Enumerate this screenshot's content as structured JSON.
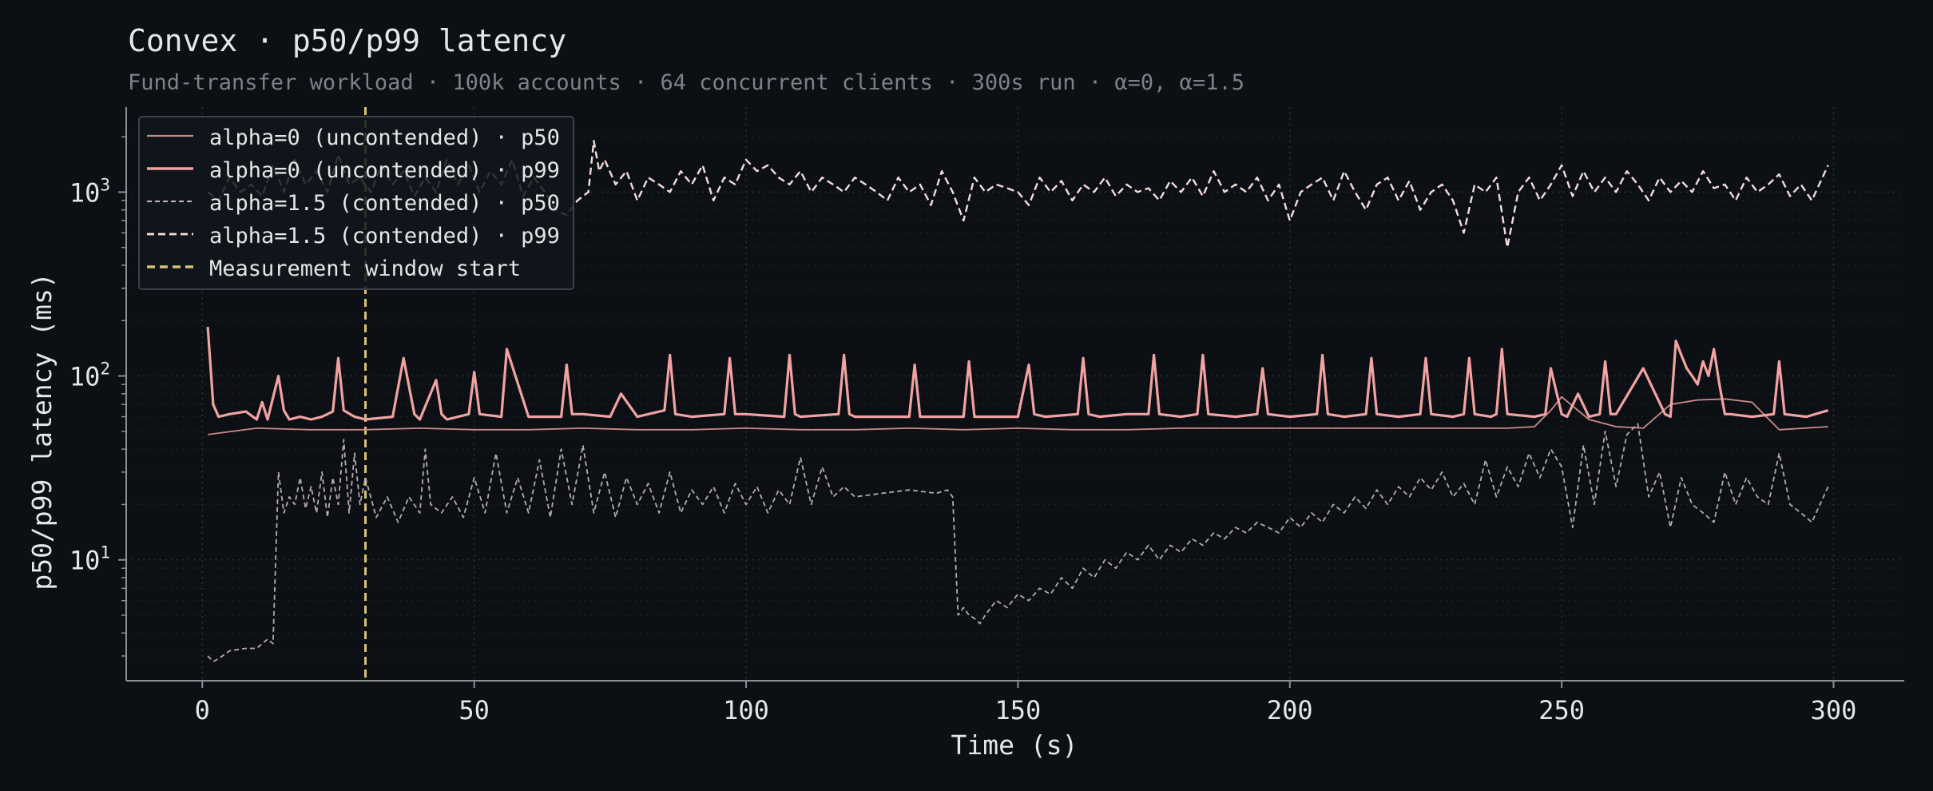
{
  "chart_data": {
    "type": "line",
    "title": "Convex · p50/p99 latency",
    "subtitle": "Fund-transfer workload · 100k accounts · 64 concurrent clients · 300s run · α=0, α=1.5",
    "xlabel": "Time (s)",
    "ylabel": "p50/p99 latency (ms)",
    "xlim": [
      -14,
      313
    ],
    "ylim": [
      2.2,
      2900
    ],
    "yscale": "log",
    "grid": true,
    "xticks": [
      0,
      50,
      100,
      150,
      200,
      250,
      300
    ],
    "xtick_labels": [
      "0",
      "50",
      "100",
      "150",
      "200",
      "250",
      "300"
    ],
    "yticks": [
      10,
      100,
      1000
    ],
    "ytick_labels": [
      {
        "base": "10",
        "exp": "1"
      },
      {
        "base": "10",
        "exp": "2"
      },
      {
        "base": "10",
        "exp": "3"
      }
    ],
    "legend_position": "top-left",
    "vline": {
      "x": 30,
      "name": "Measurement window start",
      "color": "#d8c27a"
    },
    "colors": {
      "alpha0_p50": "#c98a8a",
      "alpha0_p99": "#f2a2a2",
      "alpha15_p50": "#b8aaaa",
      "alpha15_p99": "#f4dcdc",
      "axis": "#8a8f95",
      "text": "#e6e6e6",
      "subtext": "#7c8288",
      "grid": "#2a3138"
    },
    "series": [
      {
        "name": "alpha=0 (uncontended) · p50",
        "style": "solid",
        "x": [
          1,
          10,
          20,
          30,
          40,
          50,
          60,
          70,
          80,
          90,
          100,
          110,
          120,
          130,
          140,
          150,
          160,
          170,
          180,
          190,
          200,
          210,
          220,
          230,
          240,
          245,
          248,
          250,
          255,
          260,
          265,
          270,
          275,
          280,
          285,
          290,
          299
        ],
        "values": [
          48,
          52,
          51,
          51,
          52,
          51,
          51,
          52,
          51,
          51,
          52,
          51,
          51,
          52,
          51,
          52,
          51,
          51,
          52,
          52,
          52,
          52,
          52,
          52,
          52,
          53,
          65,
          77,
          58,
          53,
          52,
          70,
          74,
          75,
          72,
          51,
          53
        ]
      },
      {
        "name": "alpha=0 (uncontended) · p99",
        "style": "solid",
        "x": [
          1,
          2,
          3,
          5,
          8,
          10,
          11,
          12,
          14,
          15,
          16,
          18,
          20,
          22,
          24,
          25,
          26,
          28,
          30,
          35,
          37,
          39,
          40,
          43,
          44,
          45,
          49,
          50,
          51,
          55,
          56,
          60,
          66,
          67,
          68,
          70,
          75,
          77,
          80,
          85,
          86,
          87,
          90,
          96,
          97,
          98,
          100,
          107,
          108,
          109,
          110,
          117,
          118,
          119,
          120,
          130,
          131,
          132,
          135,
          140,
          141,
          142,
          145,
          150,
          152,
          153,
          155,
          161,
          162,
          163,
          165,
          170,
          174,
          175,
          176,
          180,
          183,
          184,
          185,
          190,
          194,
          195,
          196,
          200,
          205,
          206,
          207,
          210,
          214,
          215,
          216,
          220,
          224,
          225,
          226,
          230,
          232,
          233,
          234,
          237,
          238,
          239,
          240,
          245,
          247,
          248,
          250,
          251,
          253,
          255,
          257,
          258,
          259,
          260,
          265,
          269,
          270,
          271,
          272,
          273,
          274,
          275,
          276,
          277,
          278,
          279,
          280,
          281,
          285,
          289,
          290,
          291,
          295,
          299
        ],
        "values": [
          185,
          70,
          60,
          62,
          64,
          58,
          72,
          58,
          100,
          65,
          58,
          60,
          58,
          60,
          64,
          125,
          65,
          60,
          58,
          60,
          125,
          62,
          58,
          95,
          62,
          58,
          62,
          105,
          62,
          60,
          140,
          60,
          60,
          115,
          62,
          62,
          60,
          80,
          60,
          65,
          130,
          62,
          60,
          62,
          125,
          62,
          62,
          60,
          130,
          62,
          60,
          62,
          130,
          62,
          60,
          60,
          115,
          60,
          60,
          60,
          120,
          60,
          60,
          60,
          115,
          62,
          60,
          62,
          125,
          62,
          60,
          62,
          62,
          130,
          62,
          60,
          62,
          130,
          62,
          60,
          62,
          110,
          62,
          60,
          62,
          130,
          62,
          60,
          62,
          125,
          62,
          60,
          62,
          125,
          62,
          60,
          62,
          125,
          62,
          60,
          62,
          140,
          62,
          60,
          62,
          110,
          62,
          60,
          80,
          60,
          62,
          120,
          62,
          62,
          110,
          62,
          60,
          155,
          130,
          110,
          100,
          90,
          120,
          100,
          140,
          90,
          62,
          62,
          60,
          62,
          120,
          62,
          60,
          65
        ]
      },
      {
        "name": "alpha=1.5 (contended) · p50",
        "style": "dashed",
        "x": [
          1,
          2,
          3,
          5,
          8,
          10,
          11,
          12,
          13,
          14,
          15,
          16,
          17,
          18,
          19,
          20,
          21,
          22,
          23,
          24,
          25,
          26,
          27,
          28,
          29,
          30,
          32,
          34,
          36,
          38,
          40,
          41,
          42,
          44,
          46,
          48,
          50,
          52,
          54,
          56,
          58,
          60,
          62,
          64,
          66,
          68,
          70,
          72,
          74,
          76,
          78,
          80,
          82,
          84,
          86,
          88,
          90,
          92,
          94,
          96,
          98,
          100,
          102,
          104,
          106,
          108,
          110,
          112,
          114,
          116,
          118,
          120,
          125,
          130,
          135,
          137,
          138,
          139,
          140,
          141,
          142,
          143,
          144,
          145,
          146,
          148,
          150,
          152,
          154,
          156,
          158,
          160,
          162,
          164,
          166,
          168,
          170,
          172,
          174,
          176,
          178,
          180,
          182,
          184,
          186,
          188,
          190,
          192,
          194,
          196,
          198,
          200,
          202,
          204,
          206,
          208,
          210,
          212,
          214,
          216,
          218,
          220,
          222,
          224,
          226,
          228,
          230,
          232,
          234,
          236,
          238,
          240,
          242,
          244,
          246,
          248,
          250,
          252,
          254,
          256,
          258,
          260,
          262,
          264,
          266,
          268,
          270,
          272,
          274,
          276,
          278,
          280,
          282,
          284,
          286,
          288,
          290,
          292,
          294,
          296,
          299
        ],
        "values": [
          3,
          2.8,
          2.9,
          3.2,
          3.3,
          3.3,
          3.5,
          3.7,
          3.5,
          30,
          18,
          22,
          20,
          28,
          19,
          25,
          18,
          30,
          17,
          28,
          20,
          45,
          18,
          38,
          20,
          28,
          17,
          22,
          16,
          22,
          18,
          40,
          20,
          18,
          22,
          17,
          28,
          18,
          38,
          18,
          28,
          18,
          35,
          17,
          40,
          20,
          42,
          18,
          30,
          17,
          28,
          20,
          26,
          18,
          30,
          18,
          24,
          20,
          25,
          18,
          26,
          20,
          25,
          18,
          24,
          20,
          36,
          20,
          32,
          22,
          25,
          22,
          23,
          24,
          23,
          24,
          22,
          5,
          5.5,
          5,
          4.8,
          4.5,
          5,
          5.5,
          6,
          5.5,
          6.5,
          6,
          7,
          6.5,
          8,
          7,
          9,
          8,
          10,
          9,
          11,
          10,
          12,
          10,
          12,
          11,
          13,
          12,
          14,
          13,
          15,
          14,
          16,
          15,
          14,
          17,
          15,
          18,
          16,
          20,
          18,
          22,
          19,
          24,
          20,
          25,
          22,
          28,
          24,
          30,
          22,
          26,
          20,
          35,
          22,
          32,
          25,
          38,
          28,
          40,
          32,
          15,
          42,
          20,
          50,
          25,
          48,
          55,
          22,
          30,
          15,
          28,
          20,
          18,
          16,
          30,
          20,
          28,
          22,
          20,
          38,
          20,
          18,
          16,
          25
        ]
      },
      {
        "name": "alpha=1.5 (contended) · p99",
        "style": "dashed",
        "x": [
          1,
          3,
          5,
          7,
          9,
          11,
          13,
          15,
          17,
          19,
          21,
          23,
          25,
          27,
          29,
          31,
          33,
          35,
          37,
          39,
          41,
          43,
          45,
          47,
          49,
          51,
          53,
          55,
          57,
          59,
          61,
          63,
          65,
          67,
          69,
          71,
          72,
          73,
          74,
          76,
          78,
          80,
          82,
          84,
          86,
          88,
          90,
          92,
          94,
          96,
          98,
          100,
          102,
          104,
          106,
          108,
          110,
          112,
          114,
          116,
          118,
          120,
          122,
          124,
          126,
          128,
          130,
          132,
          134,
          136,
          138,
          140,
          142,
          144,
          146,
          148,
          150,
          152,
          154,
          156,
          158,
          160,
          162,
          164,
          166,
          168,
          170,
          172,
          174,
          176,
          178,
          180,
          182,
          184,
          186,
          188,
          190,
          192,
          194,
          196,
          198,
          200,
          202,
          204,
          206,
          208,
          210,
          212,
          214,
          216,
          218,
          220,
          222,
          224,
          226,
          228,
          230,
          232,
          234,
          236,
          238,
          240,
          242,
          244,
          246,
          248,
          250,
          252,
          254,
          256,
          258,
          260,
          262,
          264,
          266,
          268,
          270,
          272,
          274,
          276,
          278,
          280,
          282,
          284,
          286,
          288,
          290,
          292,
          294,
          296,
          299
        ],
        "values": [
          1000,
          900,
          1200,
          1000,
          1100,
          950,
          1400,
          1000,
          1500,
          1100,
          1300,
          1000,
          1600,
          1100,
          1200,
          1000,
          1400,
          1100,
          1300,
          950,
          1200,
          1000,
          1500,
          1100,
          1400,
          1000,
          1300,
          1100,
          1500,
          950,
          1200,
          1000,
          800,
          750,
          900,
          1000,
          1900,
          1300,
          1500,
          1100,
          1300,
          900,
          1200,
          1100,
          1000,
          1300,
          1100,
          1400,
          900,
          1200,
          1100,
          1500,
          1300,
          1400,
          1200,
          1100,
          1300,
          1000,
          1200,
          1100,
          1000,
          1200,
          1100,
          1000,
          900,
          1200,
          1000,
          1100,
          850,
          1300,
          1000,
          700,
          1200,
          1000,
          1100,
          1050,
          1000,
          850,
          1200,
          1000,
          1150,
          900,
          1100,
          1000,
          1200,
          950,
          1100,
          1000,
          1050,
          900,
          1150,
          1000,
          1200,
          950,
          1300,
          1000,
          1100,
          1000,
          1200,
          900,
          1100,
          700,
          1000,
          1100,
          1200,
          900,
          1300,
          1000,
          800,
          1100,
          1200,
          900,
          1150,
          800,
          1000,
          1100,
          900,
          600,
          1100,
          1000,
          1200,
          500,
          1000,
          1200,
          900,
          1100,
          1400,
          950,
          1300,
          1000,
          1200,
          1000,
          1300,
          1100,
          900,
          1200,
          1000,
          1150,
          1000,
          1300,
          1050,
          1100,
          900,
          1200,
          1000,
          1100,
          1250,
          950,
          1100,
          900,
          1400
        ]
      }
    ]
  }
}
